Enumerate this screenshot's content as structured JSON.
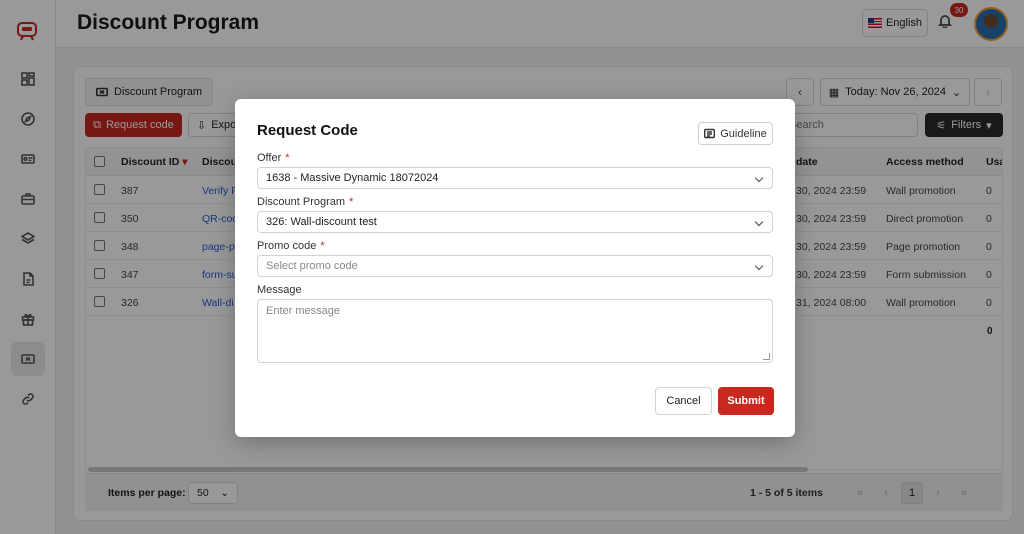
{
  "header": {
    "title": "Discount Program",
    "language": "English",
    "notification_count": "30"
  },
  "sidebar": {
    "items": [
      {
        "icon": "dashboard-icon"
      },
      {
        "icon": "compass-icon"
      },
      {
        "icon": "id-card-icon"
      },
      {
        "icon": "briefcase-icon"
      },
      {
        "icon": "layers-icon"
      },
      {
        "icon": "document-icon"
      },
      {
        "icon": "gift-icon"
      },
      {
        "icon": "ticket-icon",
        "active": true
      },
      {
        "icon": "link-icon"
      }
    ]
  },
  "toolbar": {
    "tab_label": "Discount Program",
    "date_label": "Today: Nov 26, 2024",
    "request_code_label": "Request code",
    "export_label": "Expo",
    "search_placeholder": "Search",
    "filters_label": "Filters"
  },
  "table": {
    "columns": [
      "Discount ID",
      "Discou",
      "date",
      "Access method",
      "Usa"
    ],
    "rows": [
      {
        "id": "387",
        "name": "Verify P",
        "date": "30, 2024 23:59",
        "method": "Wall promotion",
        "usage": "0"
      },
      {
        "id": "350",
        "name": "QR-cod",
        "date": "30, 2024 23:59",
        "method": "Direct promotion",
        "usage": "0"
      },
      {
        "id": "348",
        "name": "page-p",
        "date": "30, 2024 23:59",
        "method": "Page promotion",
        "usage": "0"
      },
      {
        "id": "347",
        "name": "form-su",
        "date": "30, 2024 23:59",
        "method": "Form submission",
        "usage": "0"
      },
      {
        "id": "326",
        "name": "Wall-di",
        "date": "31, 2024 08:00",
        "method": "Wall promotion",
        "usage": "0"
      }
    ],
    "total_usage": "0"
  },
  "pagination": {
    "items_per_page_label": "Items per page:",
    "items_per_page_value": "50",
    "range_text": "1 - 5 of 5 items",
    "current_page": "1"
  },
  "modal": {
    "title": "Request Code",
    "guideline_label": "Guideline",
    "offer_label": "Offer",
    "offer_value": "1638 - Massive Dynamic 18072024",
    "program_label": "Discount Program",
    "program_value": "326: Wall-discount test",
    "promo_label": "Promo code",
    "promo_placeholder": "Select promo code",
    "message_label": "Message",
    "message_placeholder": "Enter message",
    "required_mark": "*",
    "cancel_label": "Cancel",
    "submit_label": "Submit"
  },
  "colors": {
    "accent": "#c8281e",
    "dark_button": "#2b2b2b",
    "link": "#2a5bd7"
  }
}
